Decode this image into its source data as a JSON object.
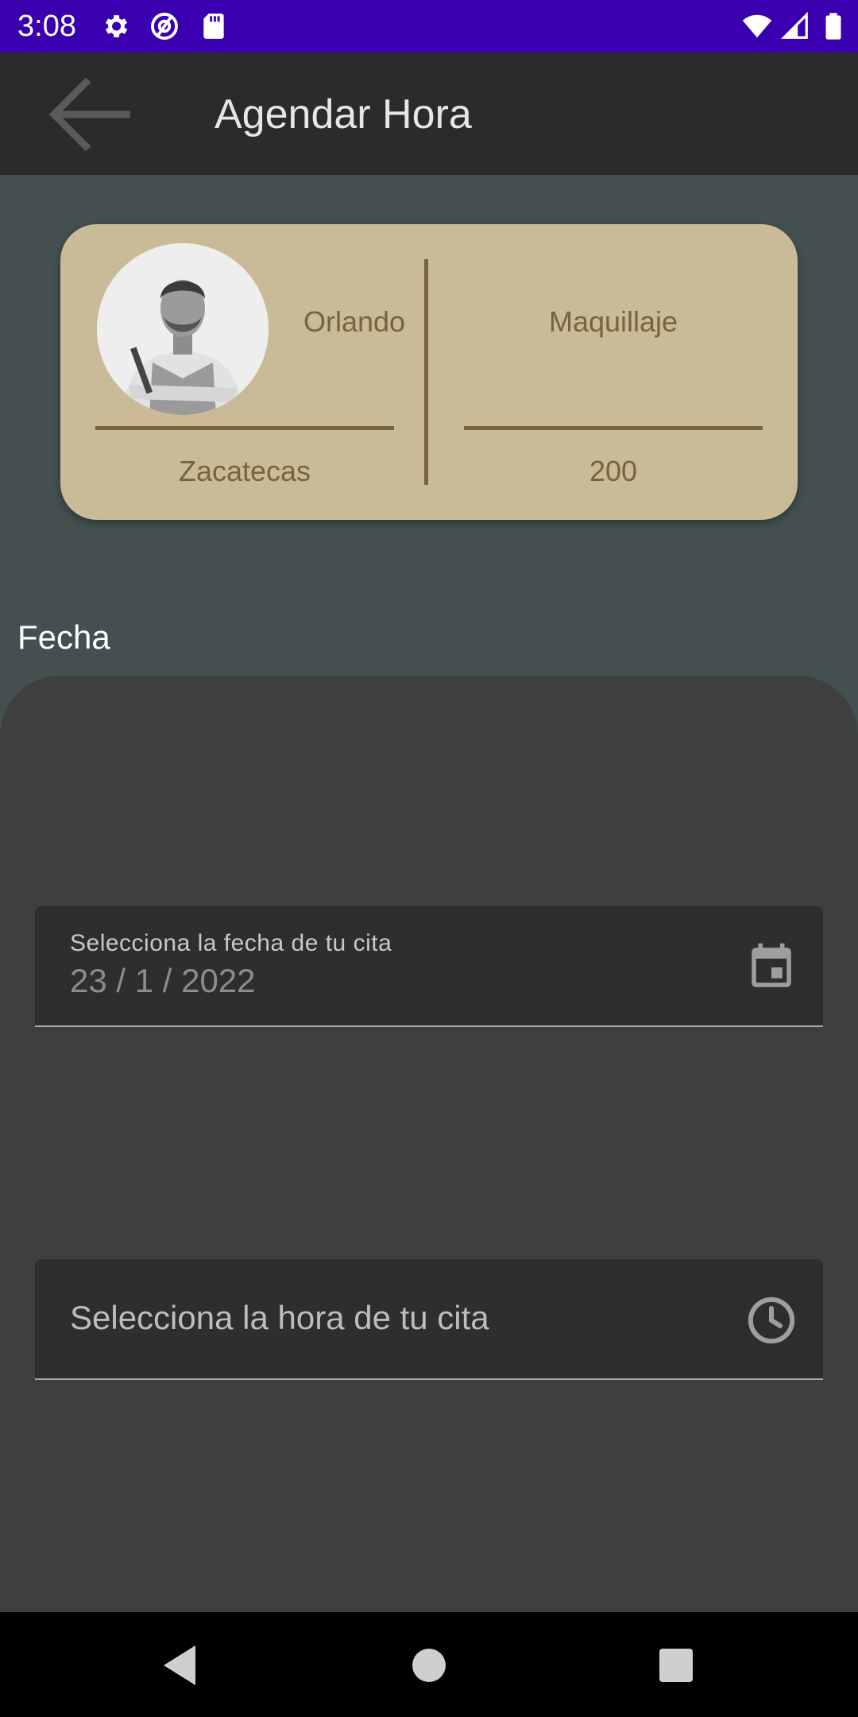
{
  "status_bar": {
    "time": "3:08",
    "left_icons": [
      "settings-icon",
      "at-sign-icon",
      "sd-card-icon"
    ],
    "right_icons": [
      "wifi-icon",
      "signal-icon",
      "battery-icon"
    ]
  },
  "app_bar": {
    "back_icon": "arrow-back-icon",
    "title": "Agendar Hora"
  },
  "card": {
    "name": "Orlando",
    "location": "Zacatecas",
    "service": "Maquillaje",
    "price": "200",
    "background_color": "#C9BA98",
    "accent_color": "#7A6239"
  },
  "section": {
    "label": "Fecha"
  },
  "date_field": {
    "label": "Selecciona la fecha de tu cita",
    "value": "23 / 1 / 2022",
    "icon": "calendar-icon"
  },
  "time_field": {
    "placeholder": "Selecciona la hora de tu cita",
    "icon": "clock-icon"
  },
  "nav_bar": {
    "buttons": [
      "back-triangle-icon",
      "home-circle-icon",
      "recents-square-icon"
    ]
  },
  "colors": {
    "status_bar": "#3A00B0",
    "app_bar": "#2B2B2B",
    "background": "#445050",
    "sheet": "#3F3F3F",
    "field": "#2E2E2E"
  }
}
